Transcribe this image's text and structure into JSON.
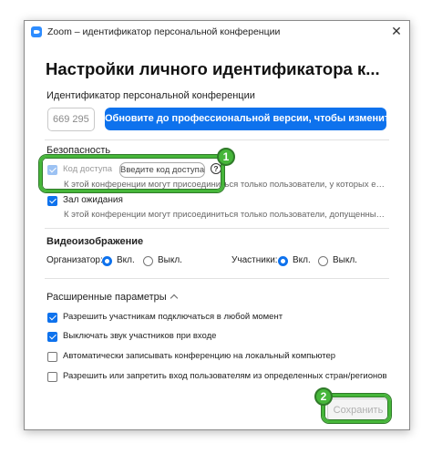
{
  "window": {
    "title": "Zoom – идентификатор персональной конференции",
    "close_glyph": "✕"
  },
  "page_title": "Настройки личного идентификатора к...",
  "pmi": {
    "label": "Идентификатор персональной конференции",
    "value": "669 295",
    "upgrade_label": "Обновите до профессиональной версии, чтобы изменить"
  },
  "security": {
    "title": "Безопасность",
    "passcode": {
      "label": "Код доступа",
      "checked": true,
      "input_placeholder": "Введите код доступа",
      "help_glyph": "?",
      "description": "К этой конференции могут присоединиться только пользователи, у которых есть с..."
    },
    "waiting_room": {
      "label": "Зал ожидания",
      "checked": true,
      "description": "К этой конференции могут присоединиться только пользователи, допущенные ор..."
    }
  },
  "video": {
    "title": "Видеоизображение",
    "host_label": "Организатор:",
    "participants_label": "Участники:",
    "on_label": "Вкл.",
    "off_label": "Выкл.",
    "host_value": "on",
    "participants_value": "on"
  },
  "advanced": {
    "title": "Расширенные параметры",
    "options": [
      {
        "label": "Разрешить участникам подключаться в любой момент",
        "checked": true
      },
      {
        "label": "Выключать звук участников при входе",
        "checked": true
      },
      {
        "label": "Автоматически записывать конференцию на локальный компьютер",
        "checked": false
      },
      {
        "label": "Разрешить или запретить вход пользователям из определенных стран/регионов",
        "checked": false
      }
    ]
  },
  "save_label": "Сохранить",
  "annotations": {
    "badge1": "1",
    "badge2": "2",
    "color": "#46b63a"
  },
  "colors": {
    "accent": "#0e72ed"
  }
}
